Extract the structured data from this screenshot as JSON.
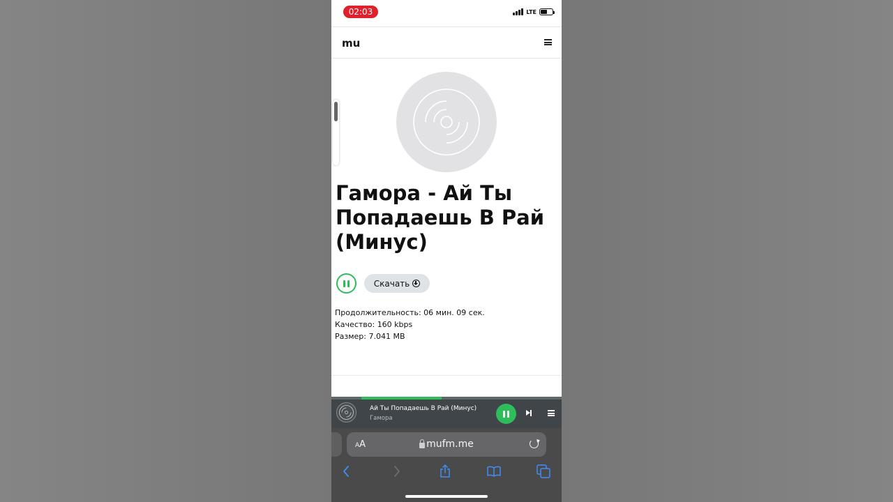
{
  "status_bar": {
    "time": "02:03",
    "network": "LTE",
    "battery_level": 0.55
  },
  "header": {
    "logo": "mu",
    "menu_icon": "hamburger-icon"
  },
  "track": {
    "cover_icon": "vinyl-disc-icon",
    "title": "Гамора - Ай Ты Попадаешь В Рай (Минус)",
    "download_label": "Скачать",
    "duration_line": "Продолжительность: 06 мин. 09 сек.",
    "quality_line": "Качество: 160 kbps",
    "size_line": "Размер: 7.041 MB"
  },
  "player": {
    "title": "Ай Ты Попадаешь В Рай (Минус)",
    "artist": "Гамора",
    "progress": 0.35,
    "state": "playing"
  },
  "browser": {
    "text_size_label": "AA",
    "url": "mufm.me",
    "toolbar_icons": [
      "back-icon",
      "forward-icon",
      "share-icon",
      "bookmarks-icon",
      "tabs-icon"
    ]
  },
  "colors": {
    "accent_green": "#2ebd5a",
    "time_pill": "#e0202a",
    "player_bg": "#3f4548",
    "browser_bg": "#4a4a4b",
    "browser_icon": "#3e8ef7"
  }
}
